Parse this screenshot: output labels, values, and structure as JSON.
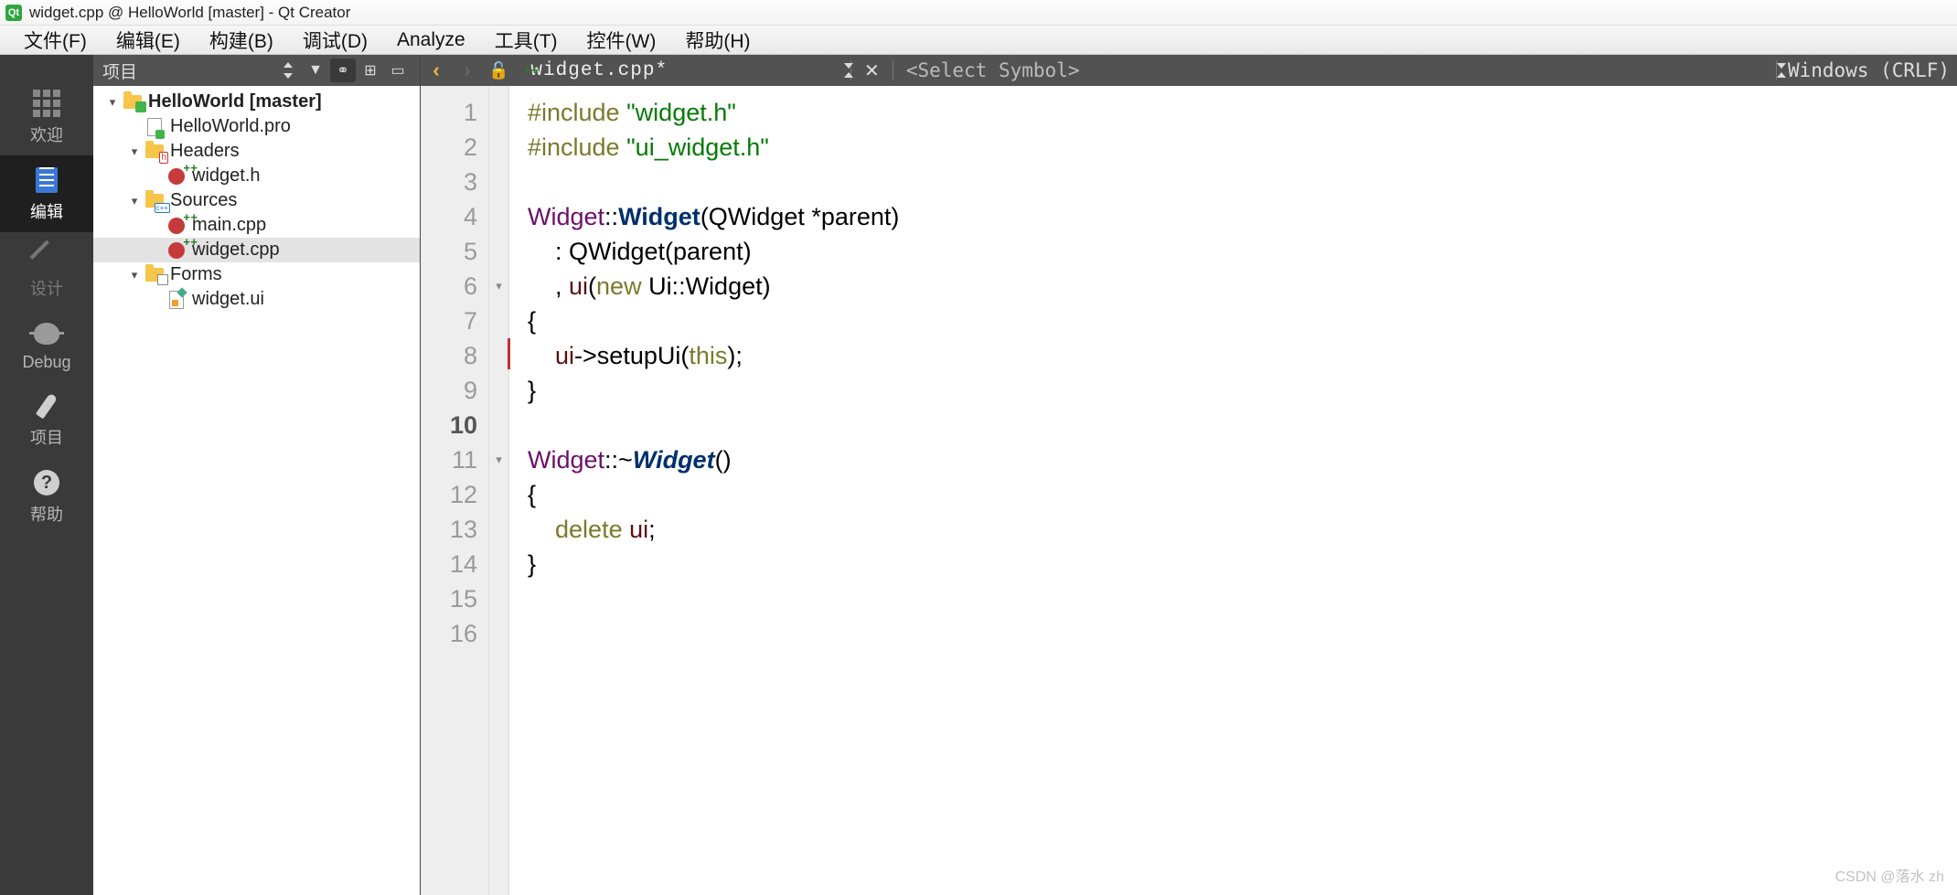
{
  "window": {
    "title": "widget.cpp @ HelloWorld [master] - Qt Creator"
  },
  "menu": {
    "file": "文件(F)",
    "edit": "编辑(E)",
    "build": "构建(B)",
    "debug": "调试(D)",
    "analyze": "Analyze",
    "tools": "工具(T)",
    "widgets": "控件(W)",
    "help": "帮助(H)"
  },
  "modes": {
    "welcome": "欢迎",
    "edit": "编辑",
    "design": "设计",
    "debug": "Debug",
    "projects": "项目",
    "help": "帮助"
  },
  "sidebar": {
    "title": "项目",
    "tree": {
      "root": "HelloWorld [master]",
      "pro": "HelloWorld.pro",
      "headers": "Headers",
      "widget_h": "widget.h",
      "sources": "Sources",
      "main_cpp": "main.cpp",
      "widget_cpp": "widget.cpp",
      "forms": "Forms",
      "widget_ui": "widget.ui"
    }
  },
  "editor": {
    "filename": "widget.cpp*",
    "symbol_placeholder": "<Select Symbol>",
    "encoding": "Windows (CRLF)",
    "line_count": 16,
    "current_line": 10,
    "fold_lines": [
      6,
      11
    ],
    "cursor_line": 8,
    "code": {
      "l1_kw": "#include",
      "l1_str": "\"widget.h\"",
      "l2_kw": "#include",
      "l2_str": "\"ui_widget.h\"",
      "l4_a": "Widget",
      "l4_b": "::",
      "l4_c": "Widget",
      "l4_d": "(QWidget *parent)",
      "l5": "    : QWidget(parent)",
      "l6_a": "    , ",
      "l6_b": "ui",
      "l6_c": "(",
      "l6_d": "new",
      "l6_e": " Ui::Widget)",
      "l7": "{",
      "l8_a": "    ",
      "l8_b": "ui",
      "l8_c": "->",
      "l8_d": "setupUi",
      "l8_e": "(",
      "l8_f": "this",
      "l8_g": ");",
      "l9": "}",
      "l11_a": "Widget",
      "l11_b": "::~",
      "l11_c": "Widget",
      "l11_d": "()",
      "l12": "{",
      "l13_a": "    ",
      "l13_b": "delete",
      "l13_c": " ",
      "l13_d": "ui",
      "l13_e": ";",
      "l14": "}"
    }
  },
  "watermark": "CSDN @落水 zh"
}
